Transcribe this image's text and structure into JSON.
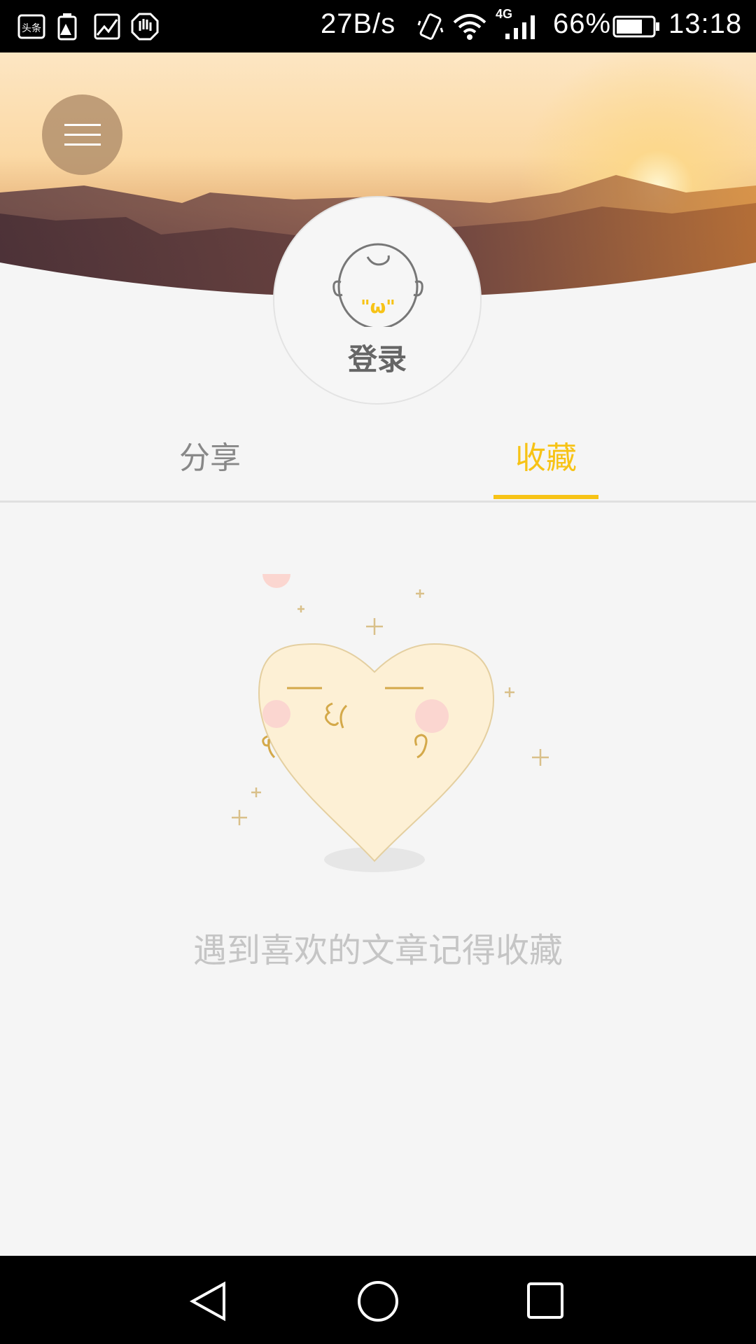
{
  "status_bar": {
    "net_speed": "27B/s",
    "network_type": "4G",
    "battery": "66%",
    "time": "13:18",
    "icons": [
      "toutiao-icon",
      "battery-warning-icon",
      "image-icon",
      "hand-icon",
      "vibrate-icon",
      "wifi-icon",
      "signal-icon",
      "battery-icon"
    ],
    "app_badge": "头条"
  },
  "header": {
    "menu_icon": "hamburger-menu-icon"
  },
  "profile": {
    "login_label": "登录",
    "avatar_icon": "baby-face-avatar-icon",
    "avatar_mouth": "\"ω\""
  },
  "tabs": [
    {
      "label": "分享",
      "active": false
    },
    {
      "label": "收藏",
      "active": true
    }
  ],
  "empty_state": {
    "message": "遇到喜欢的文章记得收藏",
    "illustration": "heart-kiss-icon"
  },
  "colors": {
    "accent": "#f7c316",
    "tab_inactive": "#888888",
    "empty_text": "#c5c5c5",
    "background": "#f5f5f5"
  },
  "nav_bar": {
    "icons": [
      "back-icon",
      "home-icon",
      "recents-icon"
    ]
  }
}
